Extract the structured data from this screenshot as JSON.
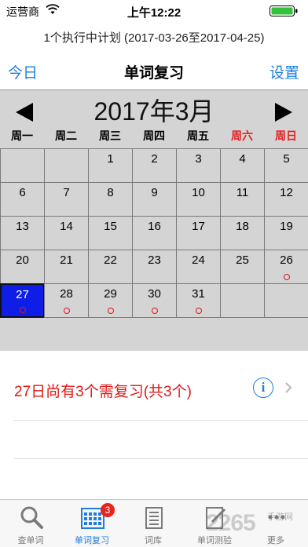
{
  "status_bar": {
    "carrier": "运营商",
    "time": "上午12:22"
  },
  "plan_subtitle": "1个执行中计划 (2017-03-26至2017-04-25)",
  "nav": {
    "left": "今日",
    "title": "单词复习",
    "right": "设置"
  },
  "calendar": {
    "month_title": "2017年3月",
    "weekdays": [
      "周一",
      "周二",
      "周三",
      "周四",
      "周五",
      "周六",
      "周日"
    ],
    "weeks": [
      [
        "",
        "",
        "1",
        "2",
        "3",
        "4",
        "5"
      ],
      [
        "6",
        "7",
        "8",
        "9",
        "10",
        "11",
        "12"
      ],
      [
        "13",
        "14",
        "15",
        "16",
        "17",
        "18",
        "19"
      ],
      [
        "20",
        "21",
        "22",
        "23",
        "24",
        "25",
        "26"
      ],
      [
        "27",
        "28",
        "29",
        "30",
        "31",
        "",
        ""
      ]
    ],
    "selected_day": "27",
    "review_dot_days": [
      "26",
      "27",
      "28",
      "29",
      "30",
      "31"
    ]
  },
  "review_summary": "27日尚有3个需复习(共3个)",
  "info_icon": "i",
  "tabs": [
    {
      "label": "查单词",
      "icon": "magnifier-icon"
    },
    {
      "label": "单词复习",
      "icon": "calendar-icon",
      "badge": "3",
      "active": true
    },
    {
      "label": "词库",
      "icon": "notepad-icon"
    },
    {
      "label": "单词测验",
      "icon": "quiz-icon"
    },
    {
      "label": "更多",
      "icon": "more-icon"
    }
  ],
  "watermark": {
    "main": "2265",
    "sub": "手游网"
  },
  "colors": {
    "accent": "#1f7de0",
    "weekend": "#e02020",
    "selected": "#0f1ee6"
  }
}
